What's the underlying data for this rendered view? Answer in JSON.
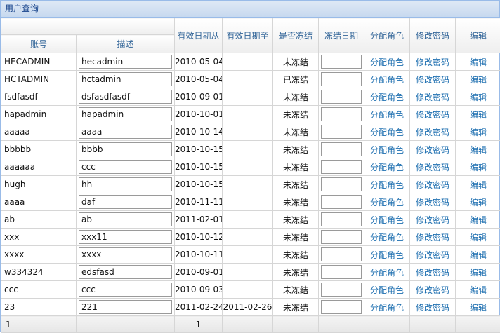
{
  "title": "用户查询",
  "columns": {
    "account": "账号",
    "description": "描述",
    "valid_from": "有效日期从",
    "valid_to": "有效日期至",
    "frozen": "是否冻结",
    "frozen_date": "冻结日期",
    "assign_role": "分配角色",
    "change_password": "修改密码",
    "edit": "编辑"
  },
  "rows": [
    {
      "account": "HECADMIN",
      "description": "hecadmin",
      "valid_from": "2010-05-04",
      "valid_to": "",
      "frozen": "未冻结",
      "frozen_date": "",
      "assign_role": "分配角色",
      "change_password": "修改密码",
      "edit": "编辑"
    },
    {
      "account": "HCTADMIN",
      "description": "hctadmin",
      "valid_from": "2010-05-04",
      "valid_to": "",
      "frozen": "已冻结",
      "frozen_date": "",
      "assign_role": "分配角色",
      "change_password": "修改密码",
      "edit": "编辑"
    },
    {
      "account": "fsdfasdf",
      "description": "dsfasdfasdf",
      "valid_from": "2010-09-01",
      "valid_to": "",
      "frozen": "未冻结",
      "frozen_date": "",
      "assign_role": "分配角色",
      "change_password": "修改密码",
      "edit": "编辑"
    },
    {
      "account": "hapadmin",
      "description": "hapadmin",
      "valid_from": "2010-10-01",
      "valid_to": "",
      "frozen": "未冻结",
      "frozen_date": "",
      "assign_role": "分配角色",
      "change_password": "修改密码",
      "edit": "编辑"
    },
    {
      "account": "aaaaa",
      "description": "aaaa",
      "valid_from": "2010-10-14",
      "valid_to": "",
      "frozen": "未冻结",
      "frozen_date": "",
      "assign_role": "分配角色",
      "change_password": "修改密码",
      "edit": "编辑"
    },
    {
      "account": "bbbbb",
      "description": "bbbb",
      "valid_from": "2010-10-15",
      "valid_to": "",
      "frozen": "未冻结",
      "frozen_date": "",
      "assign_role": "分配角色",
      "change_password": "修改密码",
      "edit": "编辑"
    },
    {
      "account": "aaaaaa",
      "description": "ccc",
      "valid_from": "2010-10-15",
      "valid_to": "",
      "frozen": "未冻结",
      "frozen_date": "",
      "assign_role": "分配角色",
      "change_password": "修改密码",
      "edit": "编辑"
    },
    {
      "account": "hugh",
      "description": "hh",
      "valid_from": "2010-10-15",
      "valid_to": "",
      "frozen": "未冻结",
      "frozen_date": "",
      "assign_role": "分配角色",
      "change_password": "修改密码",
      "edit": "编辑"
    },
    {
      "account": "aaaa",
      "description": "daf",
      "valid_from": "2010-11-11",
      "valid_to": "",
      "frozen": "未冻结",
      "frozen_date": "",
      "assign_role": "分配角色",
      "change_password": "修改密码",
      "edit": "编辑"
    },
    {
      "account": "ab",
      "description": "ab",
      "valid_from": "2011-02-01",
      "valid_to": "",
      "frozen": "未冻结",
      "frozen_date": "",
      "assign_role": "分配角色",
      "change_password": "修改密码",
      "edit": "编辑"
    },
    {
      "account": "xxx",
      "description": "xxx11",
      "valid_from": "2010-10-12",
      "valid_to": "",
      "frozen": "未冻结",
      "frozen_date": "",
      "assign_role": "分配角色",
      "change_password": "修改密码",
      "edit": "编辑"
    },
    {
      "account": "xxxx",
      "description": "xxxx",
      "valid_from": "2010-10-11",
      "valid_to": "",
      "frozen": "未冻结",
      "frozen_date": "",
      "assign_role": "分配角色",
      "change_password": "修改密码",
      "edit": "编辑"
    },
    {
      "account": "w334324",
      "description": "edsfasd",
      "valid_from": "2010-09-01",
      "valid_to": "",
      "frozen": "未冻结",
      "frozen_date": "",
      "assign_role": "分配角色",
      "change_password": "修改密码",
      "edit": "编辑"
    },
    {
      "account": "ccc",
      "description": "ccc",
      "valid_from": "2010-09-03",
      "valid_to": "",
      "frozen": "未冻结",
      "frozen_date": "",
      "assign_role": "分配角色",
      "change_password": "修改密码",
      "edit": "编辑"
    },
    {
      "account": "23",
      "description": "221",
      "valid_from": "2011-02-24",
      "valid_to": "2011-02-26",
      "frozen": "未冻结",
      "frozen_date": "",
      "assign_role": "分配角色",
      "change_password": "修改密码",
      "edit": "编辑"
    }
  ],
  "footer": {
    "account_summary": "1",
    "valid_from_summary": "1"
  }
}
